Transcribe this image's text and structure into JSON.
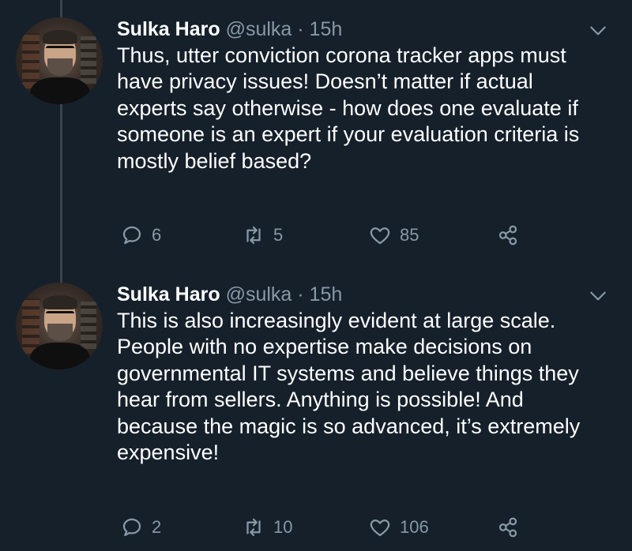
{
  "tweets": [
    {
      "author_name": "Sulka Haro",
      "handle": "@sulka",
      "separator": "·",
      "time": "15h",
      "text": "Thus, utter conviction corona tracker apps must have privacy issues! Doesn’t matter if actual experts say otherwise - how does one evaluate if someone is an expert if your evaluation criteria is mostly belief based?",
      "replies": "6",
      "retweets": "5",
      "likes": "85"
    },
    {
      "author_name": "Sulka Haro",
      "handle": "@sulka",
      "separator": "·",
      "time": "15h",
      "text": "This is also increasingly evident at large scale. People with no expertise make decisions on governmental IT systems and believe things they hear from sellers. Anything is possible! And because the magic is so advanced, it’s extremely expensive!",
      "replies": "2",
      "retweets": "10",
      "likes": "106"
    }
  ],
  "icons": {
    "reply": "reply-icon",
    "retweet": "retweet-icon",
    "like": "heart-icon",
    "share": "share-icon",
    "menu": "chevron-down-icon"
  },
  "colors": {
    "background": "#15202b",
    "secondary_text": "#8899a6",
    "thread_line": "#38444d"
  }
}
